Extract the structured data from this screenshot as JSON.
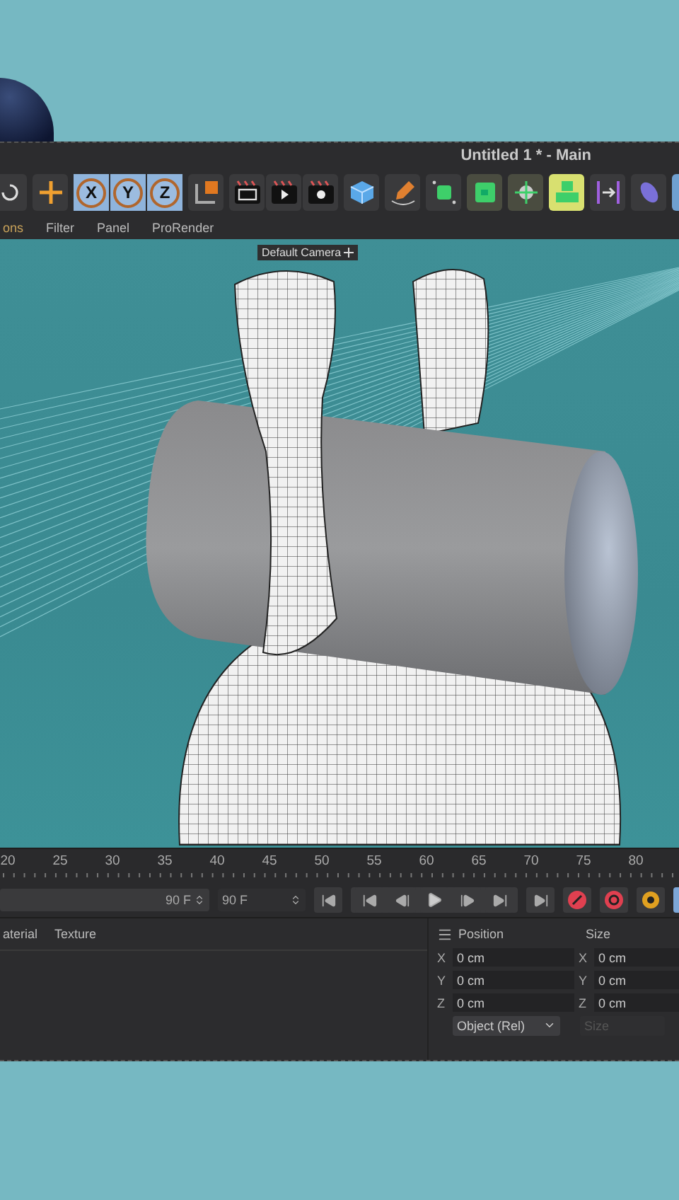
{
  "window": {
    "title": "Untitled 1 * - Main"
  },
  "axis_locks": [
    {
      "label": "X",
      "on": true
    },
    {
      "label": "Y",
      "on": true
    },
    {
      "label": "Z",
      "on": true
    }
  ],
  "menu": [
    "ons",
    "Filter",
    "Panel",
    "ProRender"
  ],
  "viewport": {
    "camera_label": "Default Camera"
  },
  "timeline": {
    "ticks": [
      "20",
      "25",
      "30",
      "35",
      "40",
      "45",
      "50",
      "55",
      "60",
      "65",
      "70",
      "75",
      "80"
    ],
    "end_frame": "90 F",
    "max_frame": "90 F"
  },
  "material_tabs": [
    "aterial",
    "Texture"
  ],
  "coordinates": {
    "position_header": "Position",
    "size_header": "Size",
    "rows": [
      {
        "axis": "X",
        "position": "0 cm",
        "size_axis": "X",
        "size": "0 cm"
      },
      {
        "axis": "Y",
        "position": "0 cm",
        "size_axis": "Y",
        "size": "0 cm"
      },
      {
        "axis": "Z",
        "position": "0 cm",
        "size_axis": "Z",
        "size": "0 cm"
      }
    ],
    "mode": "Object (Rel)",
    "size_mode": {
      "label": "Size",
      "disabled": true
    }
  }
}
